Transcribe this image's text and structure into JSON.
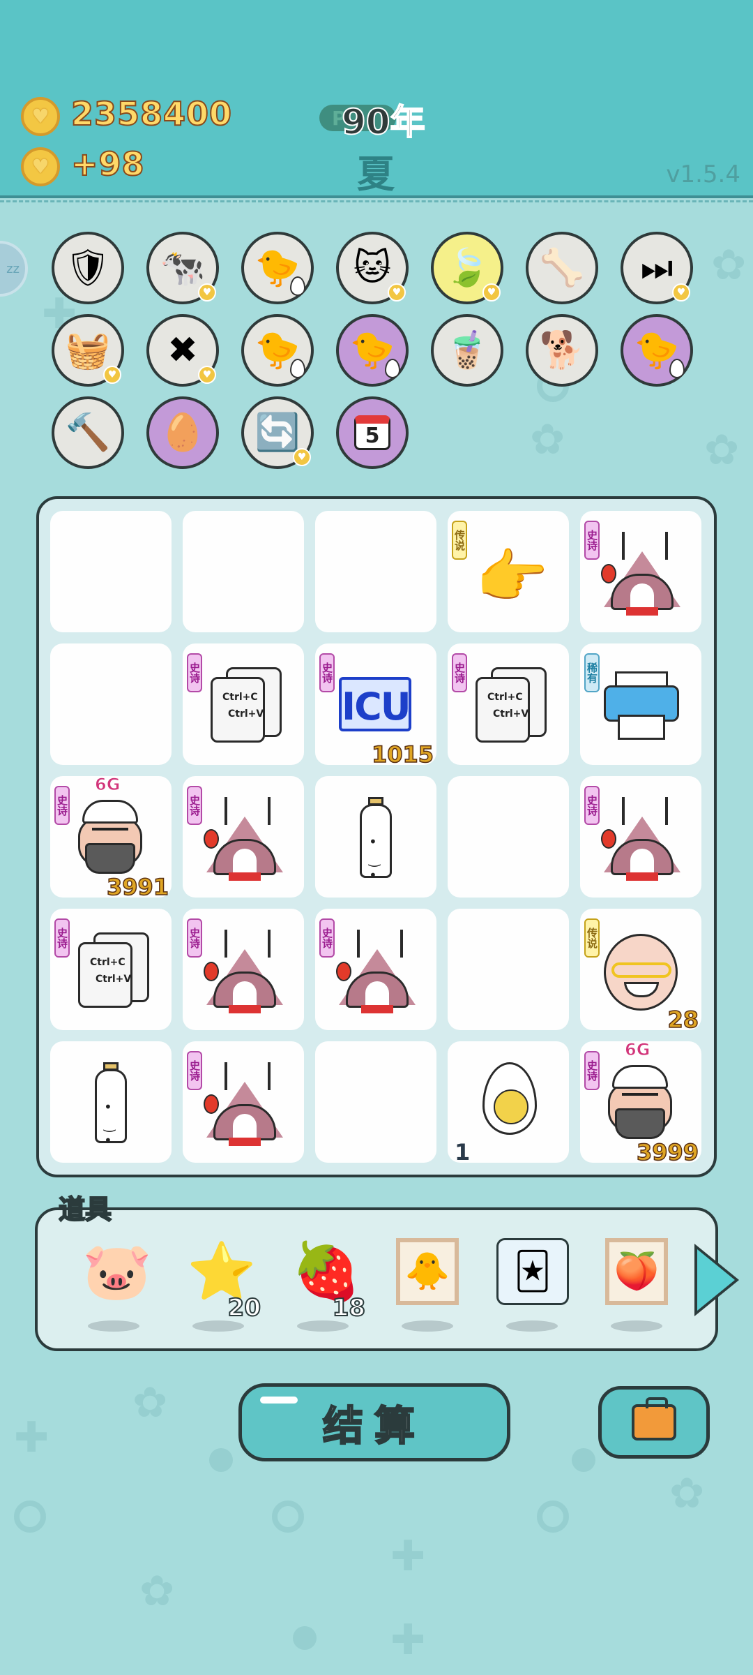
{
  "header": {
    "coins": "2358400",
    "income": "+98",
    "year": "90年",
    "year_pill": "P",
    "season": "夏",
    "version": "v1.5.4",
    "sleep_tab": "zz"
  },
  "skills": [
    {
      "icon": "shield-wrench-icon",
      "bg": "gray",
      "heart": false
    },
    {
      "icon": "cows-icon",
      "bg": "gray",
      "heart": true
    },
    {
      "icon": "chick-egg-icon",
      "bg": "gray",
      "heart": false
    },
    {
      "icon": "cat-icon",
      "bg": "gray",
      "heart": true
    },
    {
      "icon": "leaf-icon",
      "bg": "yellow",
      "heart": true
    },
    {
      "icon": "pet-bowl-icon",
      "bg": "gray",
      "heart": false
    },
    {
      "icon": "skip-icon",
      "bg": "gray",
      "heart": true
    },
    {
      "icon": "fruit-basket-icon",
      "bg": "gray",
      "heart": true
    },
    {
      "icon": "delete-tag-icon",
      "bg": "gray",
      "heart": true
    },
    {
      "icon": "chick-egg-icon",
      "bg": "gray",
      "heart": false
    },
    {
      "icon": "chick-egg-icon",
      "bg": "purple",
      "heart": false
    },
    {
      "icon": "bubble-tea-icon",
      "bg": "gray",
      "heart": false
    },
    {
      "icon": "cool-dog-icon",
      "bg": "gray",
      "heart": false
    },
    {
      "icon": "chick-egg-icon",
      "bg": "purple",
      "heart": false
    },
    {
      "icon": "hammer-icon",
      "bg": "gray",
      "heart": false
    },
    {
      "icon": "cracked-egg-icon",
      "bg": "purple",
      "heart": false
    },
    {
      "icon": "refresh-icon",
      "bg": "gray",
      "heart": true
    },
    {
      "icon": "calendar-icon",
      "bg": "purple",
      "heart": false,
      "label": "5"
    }
  ],
  "board": {
    "tags": {
      "epic": "史诗",
      "legend": "传说",
      "rare": "稀有"
    },
    "copy_text": [
      "Ctrl+C",
      "Ctrl+V"
    ],
    "icu_text": "ICU",
    "gen_label": "6G",
    "cells": [
      {
        "item": ""
      },
      {
        "item": ""
      },
      {
        "item": ""
      },
      {
        "item": "pointing-hand",
        "tag": "legend"
      },
      {
        "item": "tent",
        "tag": "epic"
      },
      {
        "item": ""
      },
      {
        "item": "copy-paste",
        "tag": "epic"
      },
      {
        "item": "icu",
        "tag": "epic",
        "count": "1015"
      },
      {
        "item": "copy-paste",
        "tag": "epic"
      },
      {
        "item": "printer",
        "tag": "rare"
      },
      {
        "item": "bearded-man",
        "tag": "epic",
        "count": "3991",
        "gen": true
      },
      {
        "item": "tent",
        "tag": "epic"
      },
      {
        "item": "milk-bottle"
      },
      {
        "item": ""
      },
      {
        "item": "tent",
        "tag": "epic"
      },
      {
        "item": "copy-paste",
        "tag": "epic"
      },
      {
        "item": "tent",
        "tag": "epic"
      },
      {
        "item": "tent",
        "tag": "epic"
      },
      {
        "item": ""
      },
      {
        "item": "old-man",
        "tag": "legend",
        "count": "28"
      },
      {
        "item": "milk-bottle"
      },
      {
        "item": "tent",
        "tag": "epic"
      },
      {
        "item": ""
      },
      {
        "item": "egg",
        "count": "1",
        "count_left": true
      },
      {
        "item": "bearded-man",
        "tag": "epic",
        "count": "3999",
        "gen": true
      }
    ]
  },
  "tools": {
    "label": "道具",
    "items": [
      {
        "icon": "piggy-bank-icon",
        "count": ""
      },
      {
        "icon": "star-icon",
        "count": "20"
      },
      {
        "icon": "bayberry-icon",
        "count": "18"
      },
      {
        "icon": "chick-portrait-icon",
        "count": ""
      },
      {
        "icon": "rare-cards-icon",
        "count": ""
      },
      {
        "icon": "peach-portrait-icon",
        "count": ""
      }
    ]
  },
  "actions": {
    "settle": "结算",
    "bag": "briefcase-icon"
  },
  "colors": {
    "header": "#5ac4c6",
    "background": "#a6dcdc",
    "board": "#d6ecee",
    "epic_tag": "#f2c4f0",
    "legend_tag": "#fff3a8",
    "rare_tag": "#cfeaf5",
    "count": "#e0a624"
  }
}
